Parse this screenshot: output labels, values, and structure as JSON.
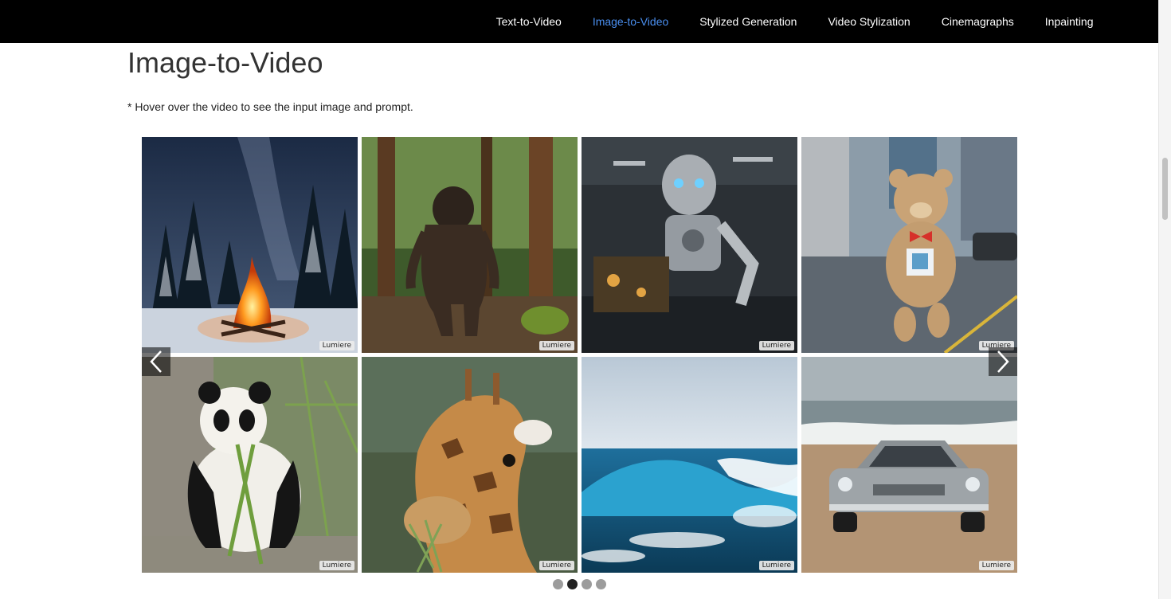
{
  "nav": {
    "items": [
      {
        "label": "Text-to-Video",
        "active": false
      },
      {
        "label": "Image-to-Video",
        "active": true
      },
      {
        "label": "Stylized Generation",
        "active": false
      },
      {
        "label": "Video Stylization",
        "active": false
      },
      {
        "label": "Cinemagraphs",
        "active": false
      },
      {
        "label": "Inpainting",
        "active": false
      }
    ],
    "active_color": "#4a8ff0"
  },
  "section": {
    "title": "Image-to-Video",
    "hint": "* Hover over the video to see the input image and prompt."
  },
  "carousel": {
    "badge": "Lumiere",
    "prev_icon": "chevron-left-icon",
    "next_icon": "chevron-right-icon",
    "tiles": [
      {
        "subject": "campfire"
      },
      {
        "subject": "bigfoot"
      },
      {
        "subject": "robot"
      },
      {
        "subject": "teddy-bear"
      },
      {
        "subject": "panda"
      },
      {
        "subject": "giraffe"
      },
      {
        "subject": "wave"
      },
      {
        "subject": "car"
      }
    ],
    "page_count": 4,
    "active_page": 2
  }
}
